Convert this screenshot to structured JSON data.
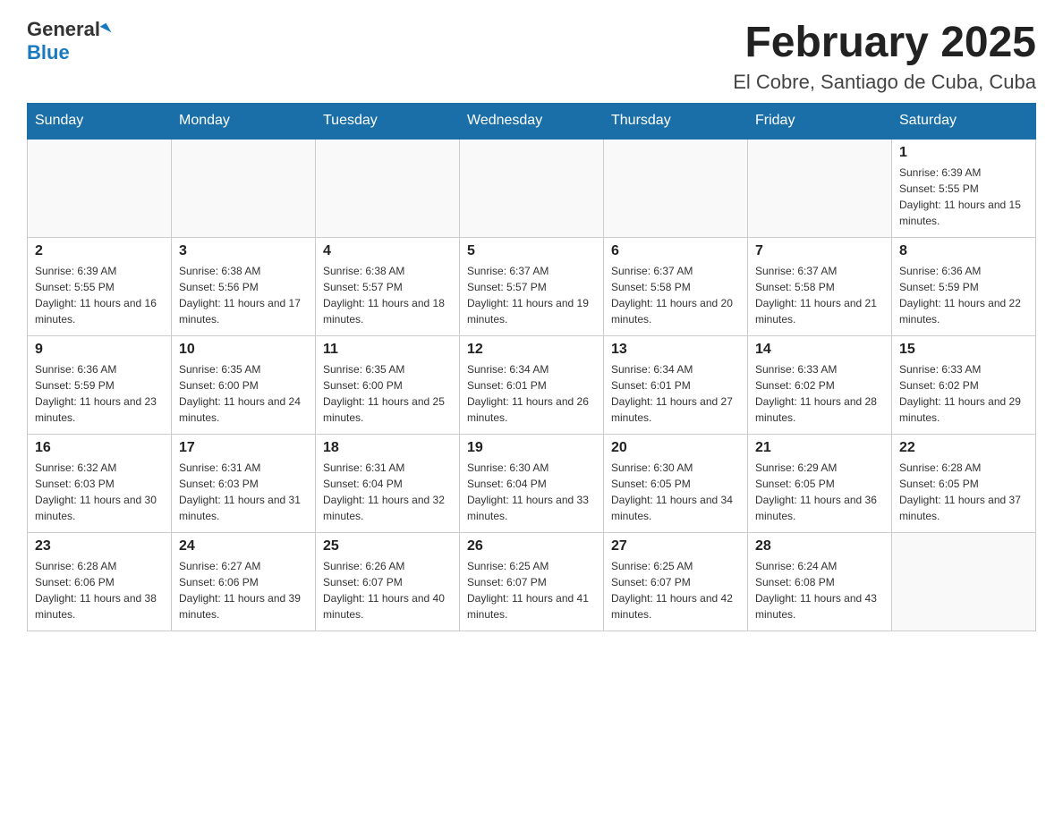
{
  "header": {
    "logo_general": "General",
    "logo_blue": "Blue",
    "title": "February 2025",
    "subtitle": "El Cobre, Santiago de Cuba, Cuba"
  },
  "days_of_week": [
    "Sunday",
    "Monday",
    "Tuesday",
    "Wednesday",
    "Thursday",
    "Friday",
    "Saturday"
  ],
  "weeks": [
    [
      {
        "day": "",
        "info": ""
      },
      {
        "day": "",
        "info": ""
      },
      {
        "day": "",
        "info": ""
      },
      {
        "day": "",
        "info": ""
      },
      {
        "day": "",
        "info": ""
      },
      {
        "day": "",
        "info": ""
      },
      {
        "day": "1",
        "info": "Sunrise: 6:39 AM\nSunset: 5:55 PM\nDaylight: 11 hours and 15 minutes."
      }
    ],
    [
      {
        "day": "2",
        "info": "Sunrise: 6:39 AM\nSunset: 5:55 PM\nDaylight: 11 hours and 16 minutes."
      },
      {
        "day": "3",
        "info": "Sunrise: 6:38 AM\nSunset: 5:56 PM\nDaylight: 11 hours and 17 minutes."
      },
      {
        "day": "4",
        "info": "Sunrise: 6:38 AM\nSunset: 5:57 PM\nDaylight: 11 hours and 18 minutes."
      },
      {
        "day": "5",
        "info": "Sunrise: 6:37 AM\nSunset: 5:57 PM\nDaylight: 11 hours and 19 minutes."
      },
      {
        "day": "6",
        "info": "Sunrise: 6:37 AM\nSunset: 5:58 PM\nDaylight: 11 hours and 20 minutes."
      },
      {
        "day": "7",
        "info": "Sunrise: 6:37 AM\nSunset: 5:58 PM\nDaylight: 11 hours and 21 minutes."
      },
      {
        "day": "8",
        "info": "Sunrise: 6:36 AM\nSunset: 5:59 PM\nDaylight: 11 hours and 22 minutes."
      }
    ],
    [
      {
        "day": "9",
        "info": "Sunrise: 6:36 AM\nSunset: 5:59 PM\nDaylight: 11 hours and 23 minutes."
      },
      {
        "day": "10",
        "info": "Sunrise: 6:35 AM\nSunset: 6:00 PM\nDaylight: 11 hours and 24 minutes."
      },
      {
        "day": "11",
        "info": "Sunrise: 6:35 AM\nSunset: 6:00 PM\nDaylight: 11 hours and 25 minutes."
      },
      {
        "day": "12",
        "info": "Sunrise: 6:34 AM\nSunset: 6:01 PM\nDaylight: 11 hours and 26 minutes."
      },
      {
        "day": "13",
        "info": "Sunrise: 6:34 AM\nSunset: 6:01 PM\nDaylight: 11 hours and 27 minutes."
      },
      {
        "day": "14",
        "info": "Sunrise: 6:33 AM\nSunset: 6:02 PM\nDaylight: 11 hours and 28 minutes."
      },
      {
        "day": "15",
        "info": "Sunrise: 6:33 AM\nSunset: 6:02 PM\nDaylight: 11 hours and 29 minutes."
      }
    ],
    [
      {
        "day": "16",
        "info": "Sunrise: 6:32 AM\nSunset: 6:03 PM\nDaylight: 11 hours and 30 minutes."
      },
      {
        "day": "17",
        "info": "Sunrise: 6:31 AM\nSunset: 6:03 PM\nDaylight: 11 hours and 31 minutes."
      },
      {
        "day": "18",
        "info": "Sunrise: 6:31 AM\nSunset: 6:04 PM\nDaylight: 11 hours and 32 minutes."
      },
      {
        "day": "19",
        "info": "Sunrise: 6:30 AM\nSunset: 6:04 PM\nDaylight: 11 hours and 33 minutes."
      },
      {
        "day": "20",
        "info": "Sunrise: 6:30 AM\nSunset: 6:05 PM\nDaylight: 11 hours and 34 minutes."
      },
      {
        "day": "21",
        "info": "Sunrise: 6:29 AM\nSunset: 6:05 PM\nDaylight: 11 hours and 36 minutes."
      },
      {
        "day": "22",
        "info": "Sunrise: 6:28 AM\nSunset: 6:05 PM\nDaylight: 11 hours and 37 minutes."
      }
    ],
    [
      {
        "day": "23",
        "info": "Sunrise: 6:28 AM\nSunset: 6:06 PM\nDaylight: 11 hours and 38 minutes."
      },
      {
        "day": "24",
        "info": "Sunrise: 6:27 AM\nSunset: 6:06 PM\nDaylight: 11 hours and 39 minutes."
      },
      {
        "day": "25",
        "info": "Sunrise: 6:26 AM\nSunset: 6:07 PM\nDaylight: 11 hours and 40 minutes."
      },
      {
        "day": "26",
        "info": "Sunrise: 6:25 AM\nSunset: 6:07 PM\nDaylight: 11 hours and 41 minutes."
      },
      {
        "day": "27",
        "info": "Sunrise: 6:25 AM\nSunset: 6:07 PM\nDaylight: 11 hours and 42 minutes."
      },
      {
        "day": "28",
        "info": "Sunrise: 6:24 AM\nSunset: 6:08 PM\nDaylight: 11 hours and 43 minutes."
      },
      {
        "day": "",
        "info": ""
      }
    ]
  ]
}
